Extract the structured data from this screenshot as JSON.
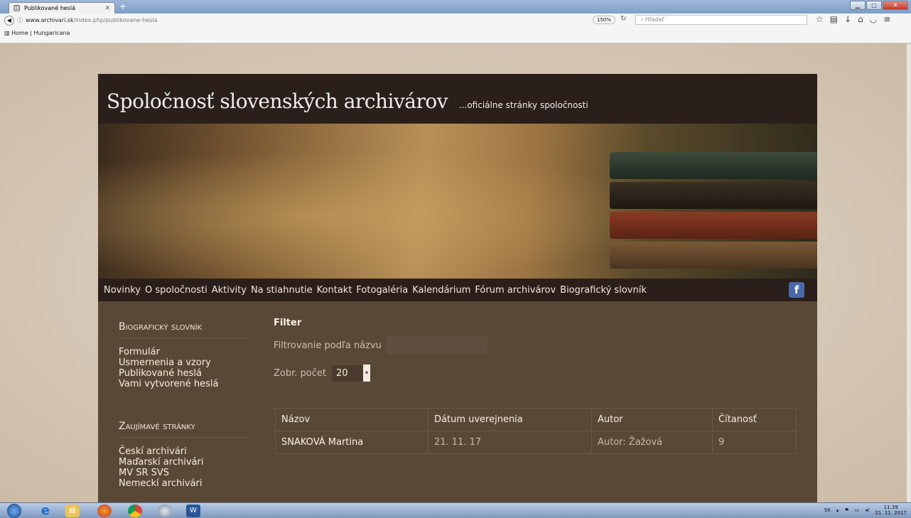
{
  "browser": {
    "tab_title": "Publikované heslá",
    "url_domain": "www.archivari.sk",
    "url_path": "/index.php/publikovane-hesla",
    "zoom": "150%",
    "search_placeholder": "Hľadať",
    "bookmark": "Home | Hungaricana"
  },
  "site": {
    "title": "Spoločnosť slovenských archivárov",
    "subtitle": "...oficiálne stránky spoločnosti"
  },
  "menu": [
    "Novinky",
    "O spoločnosti",
    "Aktivity",
    "Na stiahnutie",
    "Kontakt",
    "Fotogaléria",
    "Kalendárium",
    "Fórum archivárov",
    "Biografický slovník"
  ],
  "sidebar": {
    "section1_title": "Biografický slovník",
    "section1_links": [
      "Formulár",
      "Usmernenia a vzory",
      "Publikované heslá",
      "Vami vytvorené heslá"
    ],
    "section2_title": "Zaujímavé stránky",
    "section2_links": [
      "Českí archivári",
      "Maďarskí archivári",
      "MV SR SVS",
      "Nemeckí archivári"
    ]
  },
  "filter": {
    "heading": "Filter",
    "name_label": "Filtrovanie podľa názvu",
    "count_label": "Zobr. počet",
    "count_value": "20"
  },
  "table": {
    "headers": [
      "Názov",
      "Dátum uverejnenia",
      "Autor",
      "Čítanosť"
    ],
    "rows": [
      [
        "SNAKOVÁ Martina",
        "21. 11. 17",
        "Autor: Žažová",
        "9"
      ]
    ]
  },
  "taskbar": {
    "lang": "SK",
    "time": "11:39",
    "date": "21. 11. 2017"
  }
}
